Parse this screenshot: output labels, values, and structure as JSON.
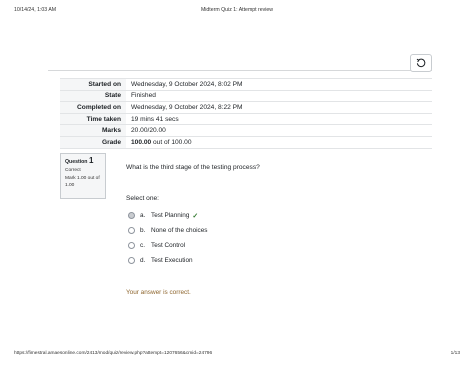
{
  "print_header": {
    "datetime": "10/14/24, 1:03 AM",
    "title": "Midterm Quiz 1: Attempt review"
  },
  "print_footer": {
    "url": "https://fimestral.amaesonline.com/2413/mod/quiz/review.php?attempt=1207656&cmid=24796",
    "page": "1/13"
  },
  "icons": {
    "block_toggle": "refresh-icon",
    "correct_mark": "check-icon"
  },
  "summary": [
    {
      "label": "Started on",
      "value": "Wednesday, 9 October 2024, 8:02 PM"
    },
    {
      "label": "State",
      "value": "Finished"
    },
    {
      "label": "Completed on",
      "value": "Wednesday, 9 October 2024, 8:22 PM"
    },
    {
      "label": "Time taken",
      "value": "19 mins 41 secs"
    },
    {
      "label": "Marks",
      "value": "20.00/20.00"
    },
    {
      "label": "Grade",
      "value_bold": "100.00",
      "value_rest": " out of 100.00"
    }
  ],
  "question": {
    "prefix": "Question",
    "number": "1",
    "state": "Correct",
    "mark": "Mark 1.00 out of 1.00",
    "text": "What is the third stage of the testing process?",
    "prompt": "Select one:",
    "options": [
      {
        "letter": "a.",
        "label": "Test Planning",
        "selected": true,
        "correct": true
      },
      {
        "letter": "b.",
        "label": "None of the choices",
        "selected": false,
        "correct": false
      },
      {
        "letter": "c.",
        "label": "Test Control",
        "selected": false,
        "correct": false
      },
      {
        "letter": "d.",
        "label": "Test Execution",
        "selected": false,
        "correct": false
      }
    ],
    "feedback": "Your answer is correct."
  },
  "colors": {
    "correct_green": "#357a32",
    "feedback_text": "#8e662e",
    "border": "#c8ccd0"
  }
}
